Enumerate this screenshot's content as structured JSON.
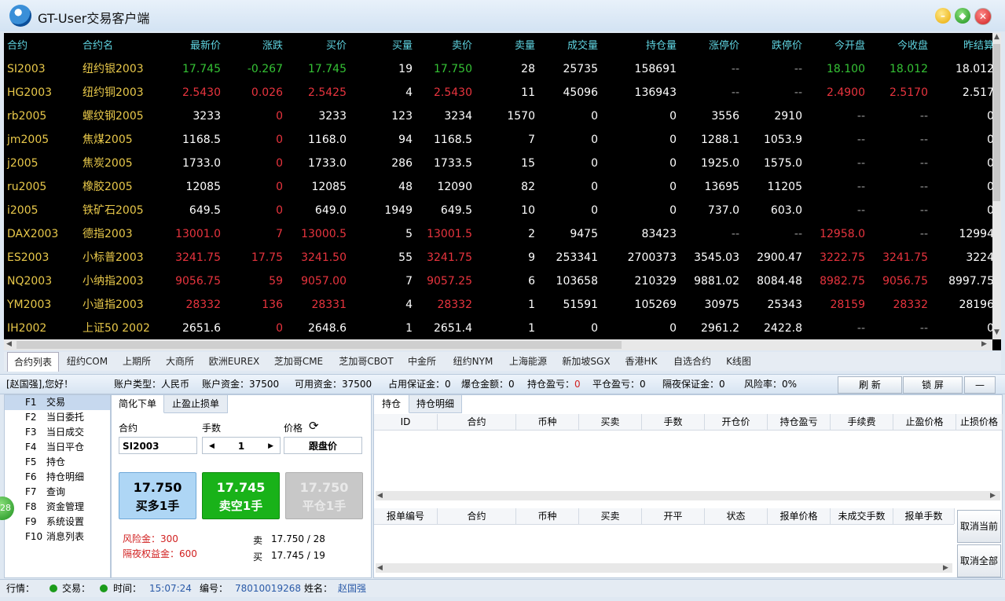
{
  "window": {
    "title": "GT-User交易客户端"
  },
  "quotes": {
    "columns": [
      "合约",
      "合约名",
      "最新价",
      "涨跌",
      "买价",
      "买量",
      "卖价",
      "卖量",
      "成交量",
      "持仓量",
      "涨停价",
      "跌停价",
      "今开盘",
      "今收盘",
      "昨结算"
    ],
    "rows": [
      [
        "SI2003",
        "纽约银2003",
        "17.745",
        "-0.267",
        "17.745",
        "19",
        "17.750",
        "28",
        "25735",
        "158691",
        "--",
        "--",
        "18.100",
        "18.012",
        "18.012"
      ],
      [
        "HG2003",
        "纽约铜2003",
        "2.5430",
        "0.026",
        "2.5425",
        "4",
        "2.5430",
        "11",
        "45096",
        "136943",
        "--",
        "--",
        "2.4900",
        "2.5170",
        "2.517"
      ],
      [
        "rb2005",
        "螺纹钢2005",
        "3233",
        "0",
        "3233",
        "123",
        "3234",
        "1570",
        "0",
        "0",
        "3556",
        "2910",
        "--",
        "--",
        "0"
      ],
      [
        "jm2005",
        "焦煤2005",
        "1168.5",
        "0",
        "1168.0",
        "94",
        "1168.5",
        "7",
        "0",
        "0",
        "1288.1",
        "1053.9",
        "--",
        "--",
        "0"
      ],
      [
        "j2005",
        "焦炭2005",
        "1733.0",
        "0",
        "1733.0",
        "286",
        "1733.5",
        "15",
        "0",
        "0",
        "1925.0",
        "1575.0",
        "--",
        "--",
        "0"
      ],
      [
        "ru2005",
        "橡胶2005",
        "12085",
        "0",
        "12085",
        "48",
        "12090",
        "82",
        "0",
        "0",
        "13695",
        "11205",
        "--",
        "--",
        "0"
      ],
      [
        "i2005",
        "铁矿石2005",
        "649.5",
        "0",
        "649.0",
        "1949",
        "649.5",
        "10",
        "0",
        "0",
        "737.0",
        "603.0",
        "--",
        "--",
        "0"
      ],
      [
        "DAX2003",
        "德指2003",
        "13001.0",
        "7",
        "13000.5",
        "5",
        "13001.5",
        "2",
        "9475",
        "83423",
        "--",
        "--",
        "12958.0",
        "--",
        "12994"
      ],
      [
        "ES2003",
        "小标普2003",
        "3241.75",
        "17.75",
        "3241.50",
        "55",
        "3241.75",
        "9",
        "253341",
        "2700373",
        "3545.03",
        "2900.47",
        "3222.75",
        "3241.75",
        "3224"
      ],
      [
        "NQ2003",
        "小纳指2003",
        "9056.75",
        "59",
        "9057.00",
        "7",
        "9057.25",
        "6",
        "103658",
        "210329",
        "9881.02",
        "8084.48",
        "8982.75",
        "9056.75",
        "8997.75"
      ],
      [
        "YM2003",
        "小道指2003",
        "28332",
        "136",
        "28331",
        "4",
        "28332",
        "1",
        "51591",
        "105269",
        "30975",
        "25343",
        "28159",
        "28332",
        "28196"
      ],
      [
        "IH2002",
        "上证50 2002",
        "2651.6",
        "0",
        "2648.6",
        "1",
        "2651.4",
        "1",
        "0",
        "0",
        "2961.2",
        "2422.8",
        "--",
        "--",
        "0"
      ]
    ],
    "colors": {
      "white": "#ffffff",
      "yellow": "#e8c84a",
      "green": "#35c235",
      "red": "#e8343e",
      "gray": "#9a9a9a"
    },
    "row_colors": [
      [
        "yellow",
        "yellow",
        "green",
        "green",
        "green",
        "white",
        "green",
        "white",
        "white",
        "white",
        "gray",
        "gray",
        "green",
        "green",
        "white"
      ],
      [
        "yellow",
        "yellow",
        "red",
        "red",
        "red",
        "white",
        "red",
        "white",
        "white",
        "white",
        "gray",
        "gray",
        "red",
        "red",
        "white"
      ],
      [
        "yellow",
        "yellow",
        "white",
        "red",
        "white",
        "white",
        "white",
        "white",
        "white",
        "white",
        "white",
        "white",
        "gray",
        "gray",
        "white"
      ],
      [
        "yellow",
        "yellow",
        "white",
        "red",
        "white",
        "white",
        "white",
        "white",
        "white",
        "white",
        "white",
        "white",
        "gray",
        "gray",
        "white"
      ],
      [
        "yellow",
        "yellow",
        "white",
        "red",
        "white",
        "white",
        "white",
        "white",
        "white",
        "white",
        "white",
        "white",
        "gray",
        "gray",
        "white"
      ],
      [
        "yellow",
        "yellow",
        "white",
        "red",
        "white",
        "white",
        "white",
        "white",
        "white",
        "white",
        "white",
        "white",
        "gray",
        "gray",
        "white"
      ],
      [
        "yellow",
        "yellow",
        "white",
        "red",
        "white",
        "white",
        "white",
        "white",
        "white",
        "white",
        "white",
        "white",
        "gray",
        "gray",
        "white"
      ],
      [
        "yellow",
        "yellow",
        "red",
        "red",
        "red",
        "white",
        "red",
        "white",
        "white",
        "white",
        "gray",
        "gray",
        "red",
        "gray",
        "white"
      ],
      [
        "yellow",
        "yellow",
        "red",
        "red",
        "red",
        "white",
        "red",
        "white",
        "white",
        "white",
        "white",
        "white",
        "red",
        "red",
        "white"
      ],
      [
        "yellow",
        "yellow",
        "red",
        "red",
        "red",
        "white",
        "red",
        "white",
        "white",
        "white",
        "white",
        "white",
        "red",
        "red",
        "white"
      ],
      [
        "yellow",
        "yellow",
        "red",
        "red",
        "red",
        "white",
        "red",
        "white",
        "white",
        "white",
        "white",
        "white",
        "red",
        "red",
        "white"
      ],
      [
        "yellow",
        "yellow",
        "white",
        "red",
        "white",
        "white",
        "white",
        "white",
        "white",
        "white",
        "white",
        "white",
        "gray",
        "gray",
        "white"
      ]
    ]
  },
  "exchange_tabs": [
    "合约列表",
    "纽约COM",
    "上期所",
    "大商所",
    "欧洲EUREX",
    "芝加哥CME",
    "芝加哥CBOT",
    "中金所",
    "纽约NYM",
    "上海能源",
    "新加坡SGX",
    "香港HK",
    "自选合约",
    "K线图"
  ],
  "account": {
    "greeting": "[赵国强],您好！",
    "type": "账户类型：人民币",
    "funds": "账户资金：37500",
    "available": "可用资金：37500",
    "margin_used": "占用保证金：0",
    "liquidation": "爆仓金额：0",
    "position_pl_label": "持仓盈亏：",
    "position_pl_value": "0",
    "close_pl": "平仓盈亏：0",
    "overnight_margin": "隔夜保证金：0",
    "risk_rate": "风险率：0%",
    "refresh_label": "刷 新",
    "lock_label": "锁 屏",
    "minimize_label": "—"
  },
  "menu": [
    {
      "key": "F1",
      "label": "交易"
    },
    {
      "key": "F2",
      "label": "当日委托"
    },
    {
      "key": "F3",
      "label": "当日成交"
    },
    {
      "key": "F4",
      "label": "当日平仓"
    },
    {
      "key": "F5",
      "label": "持仓"
    },
    {
      "key": "F6",
      "label": "持仓明细"
    },
    {
      "key": "F7",
      "label": "查询"
    },
    {
      "key": "F8",
      "label": "资金管理"
    },
    {
      "key": "F9",
      "label": "系统设置"
    },
    {
      "key": "F10",
      "label": "消息列表"
    }
  ],
  "side_badge": "28",
  "order": {
    "tabs": [
      "简化下单",
      "止盈止损单"
    ],
    "contract_label": "合约",
    "qty_label": "手数",
    "price_label": "价格",
    "contract_value": "SI2003",
    "qty_value": "1",
    "price_mode": "跟盘价",
    "buy_price": "17.750",
    "buy_label": "买多1手",
    "sell_price": "17.745",
    "sell_label": "卖空1手",
    "close_price": "17.750",
    "close_label": "平仓1手",
    "risk_fund": "风险金：300",
    "overnight_equity": "隔夜权益金：600",
    "ask_label": "卖",
    "ask_value": "17.750 / 28",
    "bid_label": "买",
    "bid_value": "17.745 / 19"
  },
  "positions": {
    "tabs": [
      "持仓",
      "持仓明细"
    ],
    "columns": [
      "ID",
      "合约",
      "币种",
      "买卖",
      "手数",
      "开仓价",
      "持仓盈亏",
      "手续费",
      "止盈价格",
      "止损价格"
    ]
  },
  "pending": {
    "columns": [
      "报单编号",
      "合约",
      "币种",
      "买卖",
      "开平",
      "状态",
      "报单价格",
      "未成交手数",
      "报单手数"
    ],
    "cancel_current": "取消当前",
    "cancel_all": "取消全部"
  },
  "status": {
    "quote_label": "行情：",
    "trade_label": "交易：",
    "time_label": "时间：",
    "time_value": "15:07:24",
    "id_label": "编号：",
    "id_value": "78010019268",
    "name_label": "姓名：",
    "name_value": "赵国强"
  }
}
